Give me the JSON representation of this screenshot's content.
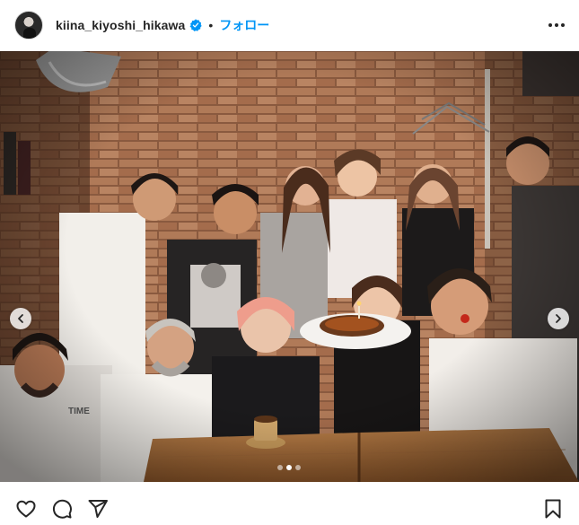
{
  "post": {
    "username": "kiina_kiyoshi_hikawa",
    "separator": "•",
    "follow_label": "フォロー"
  },
  "photo": {
    "carousel_total": 3,
    "carousel_active": 1,
    "shirt_text": "TIME"
  },
  "icons": {
    "verified": "verified-badge-icon",
    "more": "more-options-icon",
    "like": "heart-icon",
    "comment": "comment-icon",
    "share": "send-icon",
    "save": "bookmark-icon",
    "prev": "chevron-left-icon",
    "next": "chevron-right-icon"
  },
  "colors": {
    "accent": "#0095f6",
    "text": "#262626",
    "background": "#ffffff"
  }
}
